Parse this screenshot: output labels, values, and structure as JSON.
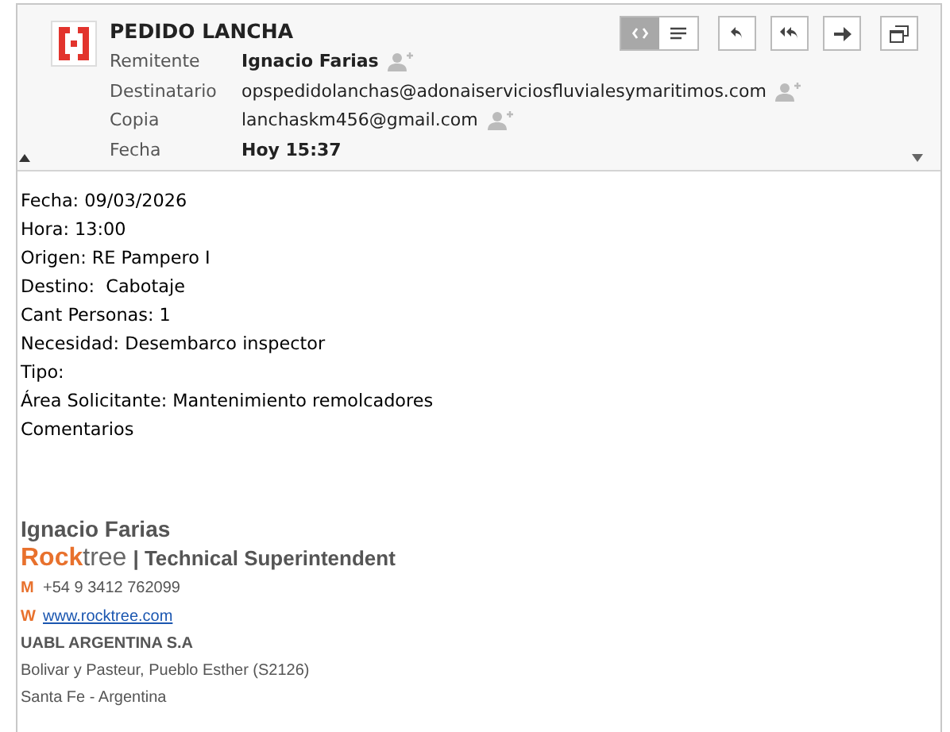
{
  "message": {
    "subject": "PEDIDO LANCHA",
    "view_modes": [
      {
        "kind": "html",
        "selected": true
      },
      {
        "kind": "text",
        "selected": false
      }
    ],
    "fields": [
      {
        "label": "Remitente",
        "value": "Ignacio Farias",
        "bold": true
      },
      {
        "label": "Destinatario",
        "value": "opspedidolanchas@adonaiserviciosfluvialesymaritimos.com",
        "bold": false
      },
      {
        "label": "Copia",
        "value": "lanchaskm456@gmail.com",
        "bold": false
      },
      {
        "label": "Fecha",
        "value": "Hoy 15:37",
        "bold": true
      }
    ],
    "body_lines": [
      "Fecha: 09/03/2026",
      "Hora: 13:00",
      "Origen: RE Pampero I",
      "Destino:  Cabotaje",
      "Cant Personas: 1",
      "Necesidad: Desembarco inspector",
      "Tipo:",
      "Área Solicitante: Mantenimiento remolcadores",
      "Comentarios"
    ],
    "signature": {
      "name": "Ignacio Farias",
      "brand_strong": "Rock",
      "brand_rest": "tree",
      "role": "| Technical Superintendent",
      "contacts": [
        {
          "letter": "M",
          "text": "+54 9 3412 762099",
          "link": false
        },
        {
          "letter": "W",
          "text": "www.rocktree.com",
          "link": true
        }
      ],
      "company": "UABL ARGENTINA S.A",
      "address_lines": [
        "Bolivar y Pasteur, Pueblo Esther (S2126)",
        "Santa Fe - Argentina"
      ]
    }
  }
}
